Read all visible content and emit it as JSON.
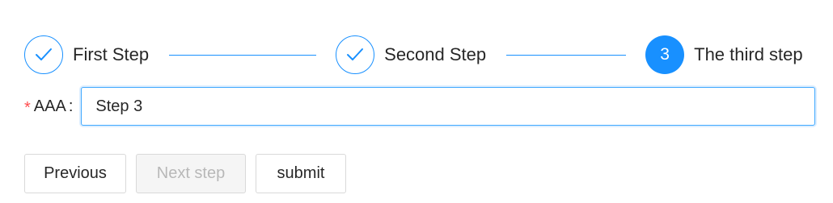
{
  "steps": [
    {
      "title": "First Step",
      "status": "finish",
      "icon": "check-icon"
    },
    {
      "title": "Second Step",
      "status": "finish",
      "icon": "check-icon"
    },
    {
      "title": "The third step",
      "status": "process",
      "number": "3"
    }
  ],
  "form": {
    "required_mark": "*",
    "label": "AAA",
    "colon": ":",
    "value": "Step 3"
  },
  "buttons": {
    "previous": "Previous",
    "next": "Next step",
    "submit": "submit"
  },
  "colors": {
    "primary": "#1890ff",
    "required": "#ff4d4f",
    "disabled_bg": "#f5f5f5",
    "border": "#d9d9d9"
  }
}
